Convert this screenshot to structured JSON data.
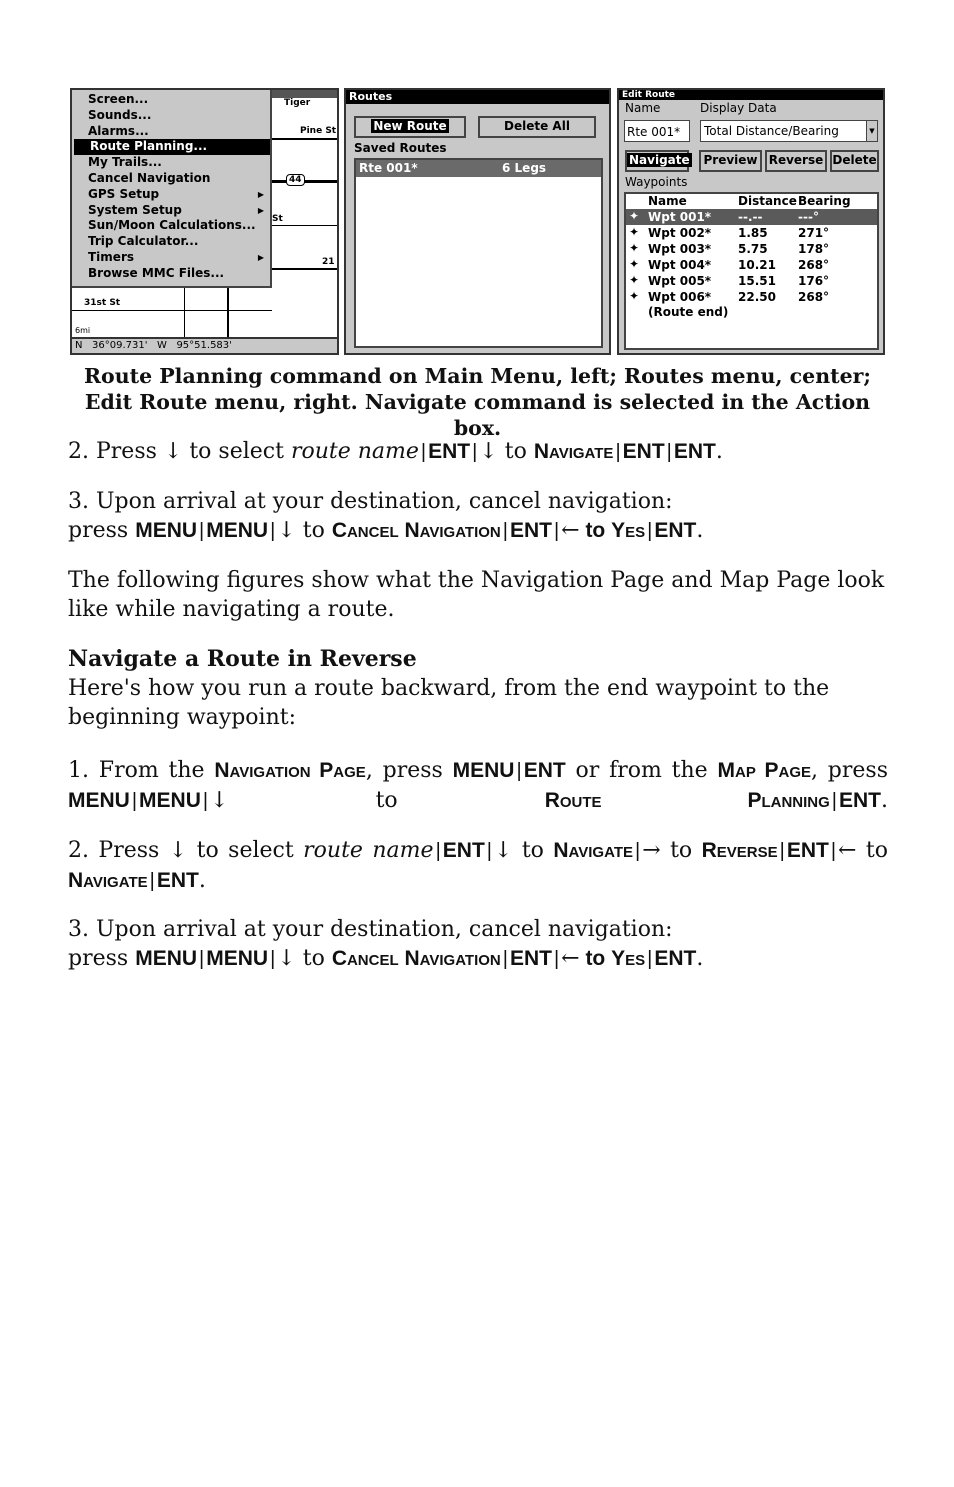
{
  "fig_left": {
    "menu_items": [
      "Screen...",
      "Sounds...",
      "Alarms...",
      "Route Planning...",
      "My Trails...",
      "Cancel Navigation",
      "GPS Setup",
      "System Setup",
      "Sun/Moon Calculations...",
      "Trip Calculator...",
      "Timers",
      "Browse MMC Files..."
    ],
    "selected_index": 3,
    "submenu_indices": [
      6,
      7,
      10
    ],
    "map_labels": [
      "Tiger",
      "Pine St",
      "44",
      "St",
      "21",
      "31st St",
      "6mi"
    ],
    "status": "N   36°09.731'   W   95°51.583'"
  },
  "fig_center": {
    "title": "Routes",
    "new_route": "New Route",
    "delete_all": "Delete All",
    "saved_routes": "Saved Routes",
    "route_name": "Rte 001*",
    "route_legs": "6 Legs"
  },
  "fig_right": {
    "title": "Edit Route",
    "name_label": "Name",
    "display_label": "Display Data",
    "name_value": "Rte 001*",
    "display_value": "Total Distance/Bearing",
    "buttons": [
      "Navigate",
      "Preview",
      "Reverse",
      "Delete"
    ],
    "selected_button": "Navigate",
    "waypoints_label": "Waypoints",
    "columns": [
      "Name",
      "Distance",
      "Bearing"
    ],
    "rows": [
      [
        "Wpt 001*",
        "--.--",
        "---°"
      ],
      [
        "Wpt 002*",
        "1.85",
        "271°"
      ],
      [
        "Wpt 003*",
        "5.75",
        "178°"
      ],
      [
        "Wpt 004*",
        "10.21",
        "268°"
      ],
      [
        "Wpt 005*",
        "15.51",
        "176°"
      ],
      [
        "Wpt 006*",
        "22.50",
        "268°"
      ]
    ],
    "route_end": "(Route end)"
  },
  "caption": [
    "Route Planning command on Main Menu, left; Routes  menu, center;",
    "Edit Route menu, right. Navigate command is selected in the Action box."
  ],
  "paragraphs": [
    [
      [
        "n",
        "2. Press "
      ],
      [
        "n",
        "↓"
      ],
      [
        "n",
        " to select "
      ],
      [
        "i",
        "route name"
      ],
      [
        "s",
        "|"
      ],
      [
        "k",
        "ENT"
      ],
      [
        "s",
        "|"
      ],
      [
        "n",
        "↓"
      ],
      [
        "n",
        " to "
      ],
      [
        "c",
        "Navigate"
      ],
      [
        "s",
        "|"
      ],
      [
        "k",
        "ENT"
      ],
      [
        "s",
        "|"
      ],
      [
        "k",
        "ENT"
      ],
      [
        "n",
        "."
      ]
    ],
    [
      [
        "n",
        "3. Upon arrival at your destination, cancel navigation:"
      ],
      [
        "br",
        ""
      ],
      [
        "n",
        "press "
      ],
      [
        "k",
        "MENU"
      ],
      [
        "s",
        "|"
      ],
      [
        "k",
        "MENU"
      ],
      [
        "s",
        "|"
      ],
      [
        "n",
        "↓"
      ],
      [
        "n",
        " to "
      ],
      [
        "c",
        "Cancel Navigation"
      ],
      [
        "s",
        "|"
      ],
      [
        "k",
        "ENT"
      ],
      [
        "s",
        "|"
      ],
      [
        "n",
        "←"
      ],
      [
        "k",
        " to "
      ],
      [
        "c",
        "Yes"
      ],
      [
        "s",
        "|"
      ],
      [
        "k",
        "ENT"
      ],
      [
        "n",
        "."
      ]
    ],
    [
      [
        "n",
        "The following figures show what the Navigation Page and Map Page look like while navigating a route."
      ]
    ],
    [
      [
        "h",
        "Navigate a Route in Reverse"
      ],
      [
        "br",
        ""
      ],
      [
        "n",
        "Here's how you run a route backward, from the end waypoint to the beginning waypoint:"
      ]
    ],
    [
      [
        "n",
        "1. From the "
      ],
      [
        "c",
        "Navigation Page"
      ],
      [
        "n",
        ", press "
      ],
      [
        "k",
        "MENU"
      ],
      [
        "s",
        "|"
      ],
      [
        "k",
        "ENT"
      ],
      [
        "n",
        " or from the "
      ],
      [
        "c",
        "Map Page"
      ],
      [
        "n",
        ", press "
      ],
      [
        "k",
        "MENU"
      ],
      [
        "s",
        "|"
      ],
      [
        "k",
        "MENU"
      ],
      [
        "s",
        "|"
      ],
      [
        "n",
        "↓"
      ],
      [
        "n",
        " to "
      ],
      [
        "c",
        "Route Planning"
      ],
      [
        "s",
        "|"
      ],
      [
        "k",
        "ENT"
      ],
      [
        "n",
        "."
      ]
    ],
    [
      [
        "n",
        "2. Press ↓ to select "
      ],
      [
        "i",
        "route name"
      ],
      [
        "s",
        "|"
      ],
      [
        "k",
        "ENT"
      ],
      [
        "s",
        "|"
      ],
      [
        "n",
        "↓"
      ],
      [
        "n",
        " to "
      ],
      [
        "c",
        "Navigate"
      ],
      [
        "s",
        "|"
      ],
      [
        "n",
        "→"
      ],
      [
        "n",
        " to "
      ],
      [
        "c",
        "Reverse"
      ],
      [
        "s",
        "|"
      ],
      [
        "k",
        "ENT"
      ],
      [
        "s",
        "|"
      ],
      [
        "n",
        "←"
      ],
      [
        "n",
        " to "
      ],
      [
        "c",
        "Navigate"
      ],
      [
        "s",
        "|"
      ],
      [
        "k",
        "ENT"
      ],
      [
        "n",
        "."
      ]
    ],
    [
      [
        "n",
        "3. Upon arrival at your destination, cancel navigation:"
      ],
      [
        "br",
        ""
      ],
      [
        "n",
        "press "
      ],
      [
        "k",
        "MENU"
      ],
      [
        "s",
        "|"
      ],
      [
        "k",
        "MENU"
      ],
      [
        "s",
        "|"
      ],
      [
        "n",
        "↓"
      ],
      [
        "n",
        " to "
      ],
      [
        "c",
        "Cancel Navigation"
      ],
      [
        "s",
        "|"
      ],
      [
        "k",
        "ENT"
      ],
      [
        "s",
        "|"
      ],
      [
        "n",
        "←"
      ],
      [
        "k",
        " to "
      ],
      [
        "c",
        "Yes"
      ],
      [
        "s",
        "|"
      ],
      [
        "k",
        "ENT"
      ],
      [
        "n",
        "."
      ]
    ]
  ]
}
